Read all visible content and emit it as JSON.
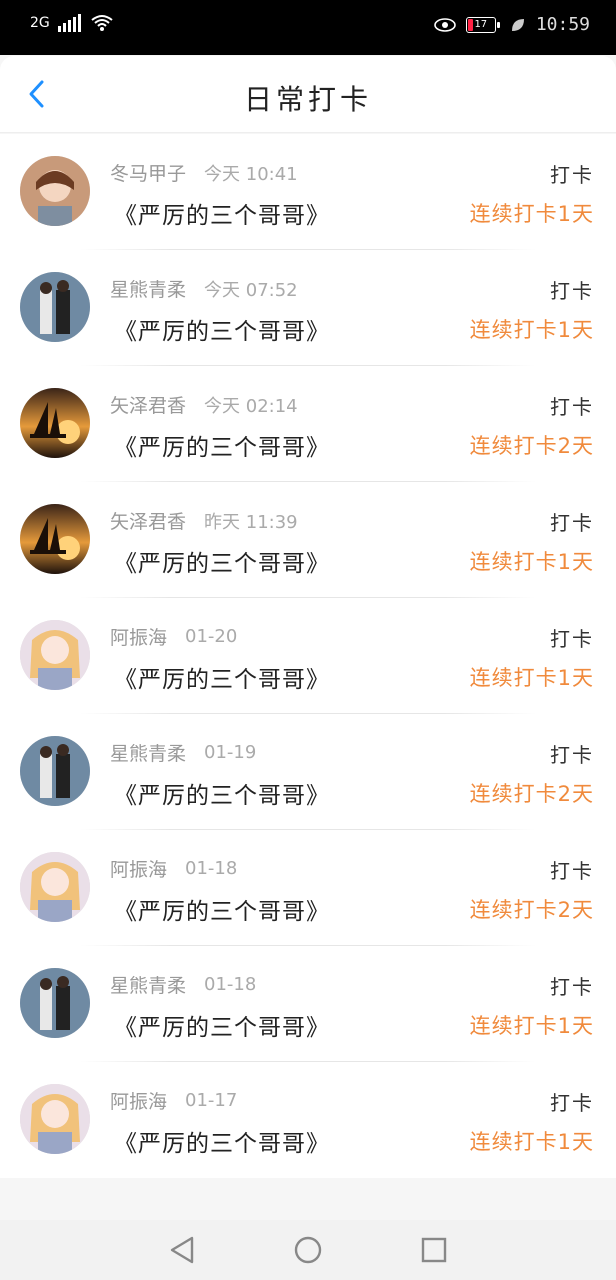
{
  "status": {
    "network": "2G",
    "battery": "17",
    "time": "10:59"
  },
  "header": {
    "title": "日常打卡"
  },
  "records": [
    {
      "user": "冬马甲子",
      "time": "今天 10:41",
      "book": "《严厉的三个哥哥》",
      "tag": "打卡",
      "streak": "连续打卡1天",
      "avatar": "girl-portrait"
    },
    {
      "user": "星熊青柔",
      "time": "今天 07:52",
      "book": "《严厉的三个哥哥》",
      "tag": "打卡",
      "streak": "连续打卡1天",
      "avatar": "couple-photo"
    },
    {
      "user": "矢泽君香",
      "time": "今天 02:14",
      "book": "《严厉的三个哥哥》",
      "tag": "打卡",
      "streak": "连续打卡2天",
      "avatar": "sunset-boat"
    },
    {
      "user": "矢泽君香",
      "time": "昨天 11:39",
      "book": "《严厉的三个哥哥》",
      "tag": "打卡",
      "streak": "连续打卡1天",
      "avatar": "sunset-boat"
    },
    {
      "user": "阿振海",
      "time": "01-20",
      "book": "《严厉的三个哥哥》",
      "tag": "打卡",
      "streak": "连续打卡1天",
      "avatar": "anime-girl"
    },
    {
      "user": "星熊青柔",
      "time": "01-19",
      "book": "《严厉的三个哥哥》",
      "tag": "打卡",
      "streak": "连续打卡2天",
      "avatar": "couple-photo"
    },
    {
      "user": "阿振海",
      "time": "01-18",
      "book": "《严厉的三个哥哥》",
      "tag": "打卡",
      "streak": "连续打卡2天",
      "avatar": "anime-girl"
    },
    {
      "user": "星熊青柔",
      "time": "01-18",
      "book": "《严厉的三个哥哥》",
      "tag": "打卡",
      "streak": "连续打卡1天",
      "avatar": "couple-photo"
    },
    {
      "user": "阿振海",
      "time": "01-17",
      "book": "《严厉的三个哥哥》",
      "tag": "打卡",
      "streak": "连续打卡1天",
      "avatar": "anime-girl"
    }
  ],
  "colors": {
    "accent": "#1e90ff",
    "streak": "#f08a3c"
  }
}
